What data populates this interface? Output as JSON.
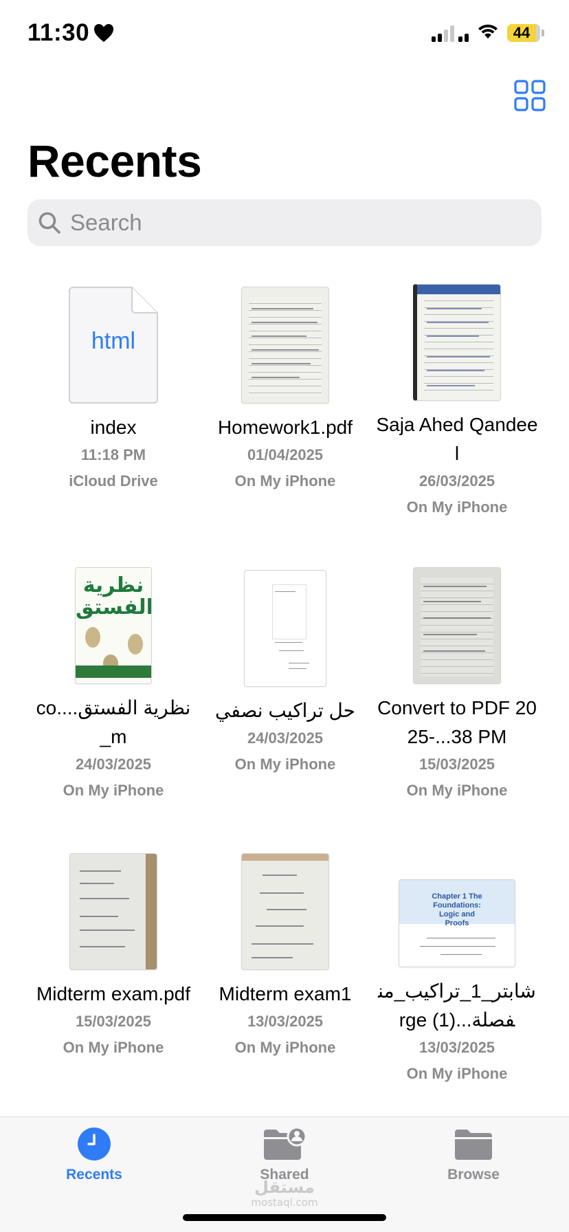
{
  "status_bar": {
    "time": "11:30",
    "battery": "44",
    "icons": [
      "heart-icon",
      "cellular-signal-icon",
      "wifi-icon",
      "battery-icon"
    ]
  },
  "header": {
    "title": "Recents",
    "grid_toggle_icon": "grid-view-icon"
  },
  "search": {
    "placeholder": "Search"
  },
  "files": [
    {
      "name": "index",
      "date": "11:18 PM",
      "location": "iCloud Drive",
      "thumb": "html",
      "thumb_label": "html"
    },
    {
      "name": "Homework1.pdf",
      "date": "01/04/2025",
      "location": "On My iPhone",
      "thumb": "notes"
    },
    {
      "name": "Saja Ahed Qandeel",
      "date": "26/03/2025",
      "location": "On My iPhone",
      "thumb": "notes"
    },
    {
      "name": "نظرية الفستق....com_",
      "date": "24/03/2025",
      "location": "On My iPhone",
      "thumb": "book",
      "thumb_label": "نظرية الفستق"
    },
    {
      "name": "حل تراكيب نصفي",
      "date": "24/03/2025",
      "location": "On My iPhone",
      "thumb": "doc"
    },
    {
      "name": "Convert to PDF 2025-...38 PM",
      "date": "15/03/2025",
      "location": "On My iPhone",
      "thumb": "notes"
    },
    {
      "name": "Midterm exam.pdf",
      "date": "15/03/2025",
      "location": "On My iPhone",
      "thumb": "notes"
    },
    {
      "name": "Midterm exam1",
      "date": "13/03/2025",
      "location": "On My iPhone",
      "thumb": "notes"
    },
    {
      "name": "شابتر_1_تراكيب_منفصلة...rge (1)",
      "date": "13/03/2025",
      "location": "On My iPhone",
      "thumb": "slide",
      "thumb_label": "Chapter 1 The Foundations: Logic and Proofs"
    }
  ],
  "tab_bar": {
    "tabs": [
      {
        "label": "Recents",
        "icon": "clock-icon",
        "active": true
      },
      {
        "label": "Shared",
        "icon": "shared-folder-icon",
        "active": false
      },
      {
        "label": "Browse",
        "icon": "folder-icon",
        "active": false
      }
    ]
  },
  "watermark": {
    "arabic": "مستقل",
    "latin": "mostaql.com"
  },
  "colors": {
    "accent": "#2f7cf6",
    "secondary_text": "#8a8a8e",
    "inactive_tab": "#8e8e93",
    "battery": "#f5d33a"
  }
}
